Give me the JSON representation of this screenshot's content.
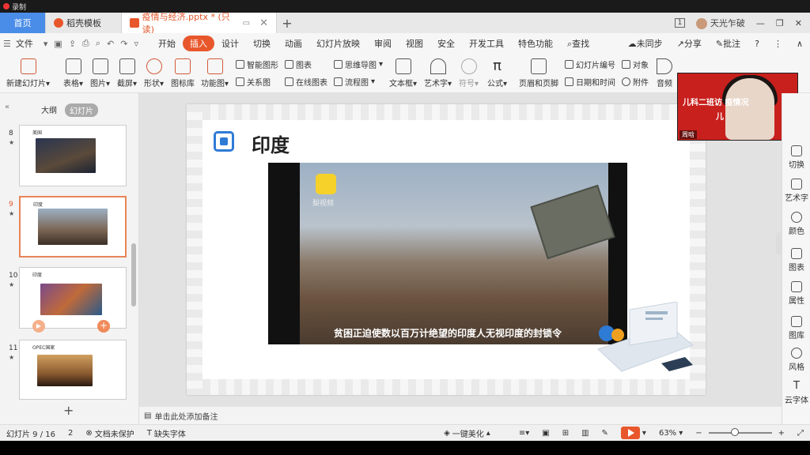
{
  "recording": {
    "label": "录制"
  },
  "tabs": {
    "home": "首页",
    "template": "稻壳模板",
    "document": "疫情与经济.pptx * (只读)",
    "page_badge": "1",
    "user": "天光乍破"
  },
  "menu": {
    "file": "文件",
    "items": [
      "开始",
      "插入",
      "设计",
      "切换",
      "动画",
      "幻灯片放映",
      "审阅",
      "视图",
      "安全",
      "开发工具",
      "特色功能"
    ],
    "active": "插入",
    "search": "查找",
    "unsynced": "未同步",
    "share": "分享",
    "comment": "批注"
  },
  "ribbon": {
    "new_slide": "新建幻灯片",
    "table": "表格",
    "picture": "图片",
    "screenshot": "截屏",
    "shape": "形状",
    "icon_lib": "图标库",
    "func_chart": "功能图",
    "smart_graphic": "智能图形",
    "chart": "图表",
    "relation": "关系图",
    "online_chart": "在线图表",
    "mindmap": "思维导图",
    "flowchart": "流程图",
    "textbox": "文本框",
    "wordart": "艺术字",
    "symbol": "符号",
    "formula": "公式",
    "header_footer": "页眉和页脚",
    "slide_number": "幻灯片编号",
    "object": "对象",
    "datetime": "日期和时间",
    "attachment": "附件",
    "audio": "音频"
  },
  "leftpane": {
    "outline": "大纲",
    "slides": "幻灯片",
    "thumbs": [
      {
        "num": "8",
        "title": "美国"
      },
      {
        "num": "9",
        "title": "印度"
      },
      {
        "num": "10",
        "title": "印度"
      },
      {
        "num": "11",
        "title": "OPEC国家"
      }
    ]
  },
  "slide": {
    "title": "印度",
    "video_logo": "梨视频",
    "caption": "贫困正迫使数以百万计绝望的印度人无视印度的封锁令"
  },
  "webcam": {
    "banner": "儿科二班访        疫情况",
    "banner2": "儿",
    "name": "周晗"
  },
  "rail": [
    "切换",
    "艺术字",
    "颜色",
    "图表",
    "属性",
    "图库",
    "风格",
    "云字体"
  ],
  "notes": {
    "placeholder": "单击此处添加备注"
  },
  "status": {
    "slide_pos": "幻灯片 9 / 16",
    "count": "2",
    "protect": "文档未保护",
    "missing_font": "缺失字体",
    "beautify": "一键美化",
    "zoom": "63%"
  },
  "colors": {
    "accent": "#e8572b",
    "home_tab": "#4a8de8",
    "webcam_bg": "#c8201d"
  }
}
